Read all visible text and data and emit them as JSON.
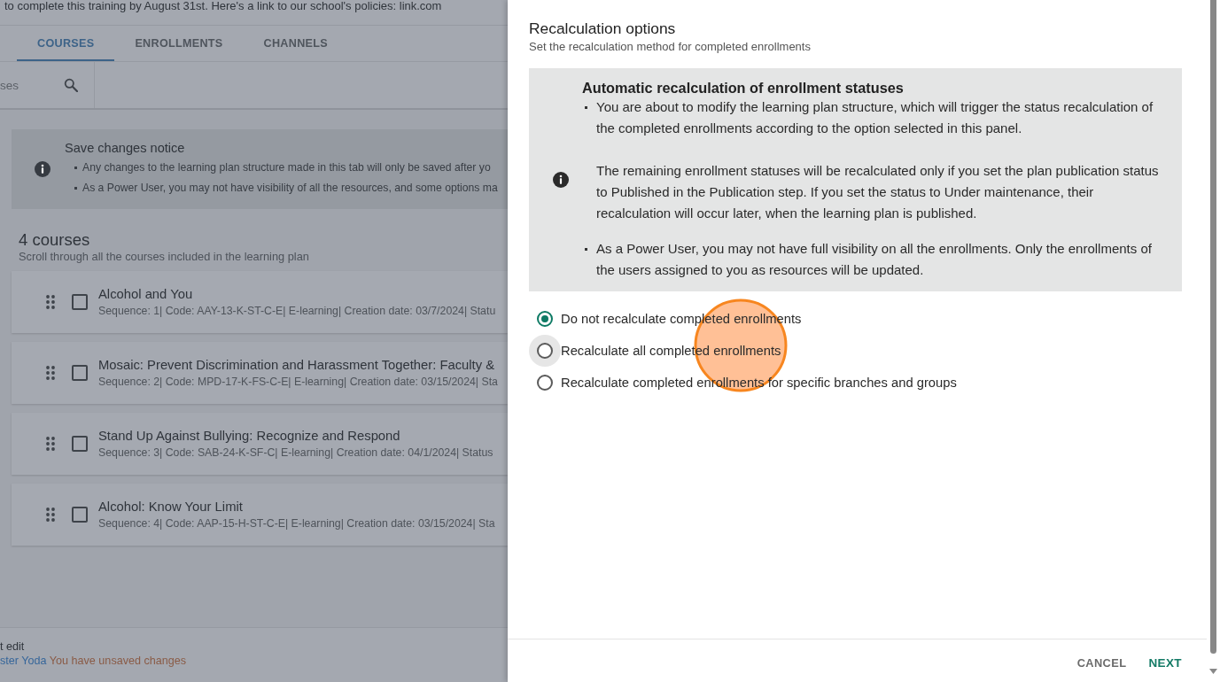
{
  "background_page": {
    "description": "to complete this training by August 31st.  Here's a link to our school's policies: link.com",
    "tabs": [
      {
        "label": "COURSES",
        "selected": true
      },
      {
        "label": "ENROLLMENTS",
        "selected": false
      },
      {
        "label": "CHANNELS",
        "selected": false
      }
    ],
    "search": {
      "placeholder": "ses"
    },
    "notice": {
      "title": "Save changes notice",
      "items": [
        "Any changes to the learning plan structure made in this tab will only be saved after yo",
        "As a Power User, you may not have visibility of all the resources, and some options ma"
      ]
    },
    "courses_header": {
      "title": "4 courses",
      "subtitle": "Scroll through all the courses included in the learning plan"
    },
    "courses": [
      {
        "title": "Alcohol and You",
        "details": "Sequence: 1| Code: AAY-13-K-ST-C-E| E-learning| Creation date: 03/7/2024| Statu",
        "checked": false
      },
      {
        "title": "Mosaic: Prevent Discrimination and Harassment Together: Faculty &",
        "details": "Sequence: 2| Code: MPD-17-K-FS-C-E| E-learning| Creation date: 03/15/2024| Sta",
        "checked": false
      },
      {
        "title": "Stand Up Against Bullying: Recognize and Respond",
        "details": "Sequence: 3| Code: SAB-24-K-SF-C| E-learning| Creation date: 04/1/2024| Status",
        "checked": false
      },
      {
        "title": "Alcohol: Know Your Limit",
        "details": "Sequence: 4| Code: AAP-15-H-ST-C-E| E-learning| Creation date: 03/15/2024| Sta",
        "checked": false
      }
    ],
    "footer": {
      "label": "t edit",
      "author": "ster Yoda",
      "status": "You have unsaved changes"
    }
  },
  "drawer": {
    "title": "Recalculation options",
    "subtitle": "Set the recalculation method for completed enrollments",
    "info_box": {
      "title": "Automatic recalculation of enrollment statuses",
      "blocks": [
        {
          "kind": "bullet",
          "text": "You are about to modify the learning plan structure, which will trigger the status recalculation of the completed enrollments according to the option selected in this panel."
        },
        {
          "kind": "paragraph",
          "text": "The remaining enrollment statuses will be recalculated only if you set the plan publication status to Published in the Publication step. If you set the status to Under maintenance, their recalculation will occur later, when the learning plan is published."
        },
        {
          "kind": "bullet",
          "text": "As a Power User, you may not have full visibility on all the enrollments. Only the enrollments of the users assigned to you as resources will be updated."
        }
      ]
    },
    "options": [
      {
        "label": "Do not recalculate completed enrollments",
        "selected": true,
        "hovered": false
      },
      {
        "label": "Recalculate all completed enrollments",
        "selected": false,
        "hovered": true
      },
      {
        "label": "Recalculate completed enrollments for specific branches and groups",
        "selected": false,
        "hovered": false
      }
    ],
    "buttons": [
      {
        "label": "CANCEL",
        "kind": "secondary"
      },
      {
        "label": "NEXT",
        "kind": "primary"
      }
    ]
  }
}
